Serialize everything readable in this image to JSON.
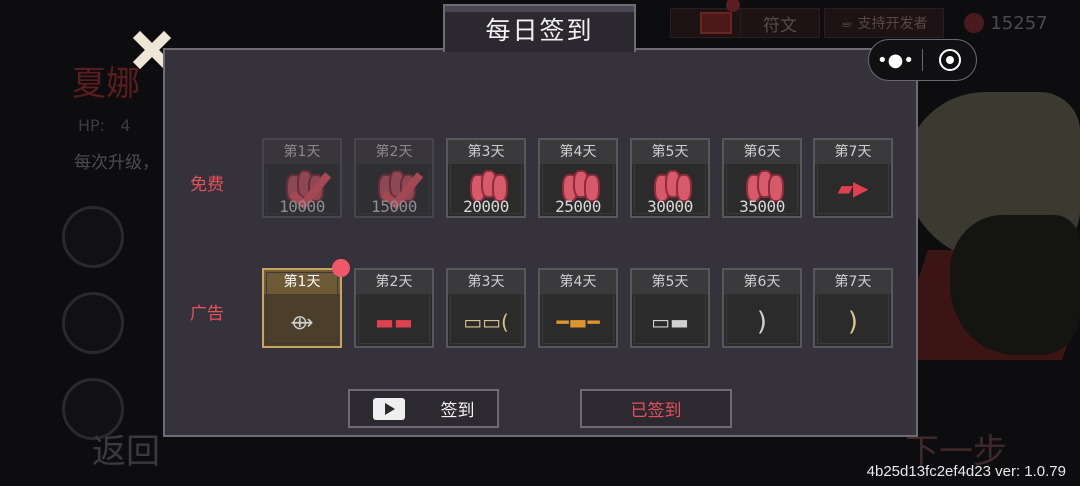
{
  "background": {
    "character_name": "夏娜",
    "hp_label": "HP:",
    "hp_value": "4",
    "upgrade_text": "每次升级，",
    "back_label": "返回",
    "next_label": "下一步",
    "top_bar": {
      "runes_label": "符文",
      "support_label": "支持开发者",
      "coins": "15257"
    }
  },
  "dialog": {
    "title": "每日签到",
    "free_row": {
      "label": "免费",
      "days": [
        {
          "day": "第1天",
          "amount": "10000",
          "claimed": true,
          "icon": "coins-icon"
        },
        {
          "day": "第2天",
          "amount": "15000",
          "claimed": true,
          "icon": "coins-icon"
        },
        {
          "day": "第3天",
          "amount": "20000",
          "claimed": false,
          "icon": "coins-icon"
        },
        {
          "day": "第4天",
          "amount": "25000",
          "claimed": false,
          "icon": "coins-icon"
        },
        {
          "day": "第5天",
          "amount": "30000",
          "claimed": false,
          "icon": "coins-icon"
        },
        {
          "day": "第6天",
          "amount": "35000",
          "claimed": false,
          "icon": "coins-icon"
        },
        {
          "day": "第7天",
          "amount": "",
          "claimed": false,
          "icon": "red-gun-icon"
        }
      ]
    },
    "ad_row": {
      "label": "广告",
      "days": [
        {
          "day": "第1天",
          "active": true,
          "icon": "crossbow-icon"
        },
        {
          "day": "第2天",
          "active": false,
          "icon": "red-blaster-icon"
        },
        {
          "day": "第3天",
          "active": false,
          "icon": "khaki-gun-icon"
        },
        {
          "day": "第4天",
          "active": false,
          "icon": "orange-rifle-icon"
        },
        {
          "day": "第5天",
          "active": false,
          "icon": "silver-pistol-icon"
        },
        {
          "day": "第6天",
          "active": false,
          "icon": "bow-icon"
        },
        {
          "day": "第7天",
          "active": false,
          "icon": "golden-bow-icon"
        }
      ]
    },
    "ad_button_label": "签到",
    "signed_button_label": "已签到"
  },
  "version_text": "4b25d13fc2ef4d23 ver: 1.0.79",
  "colors": {
    "accent_red": "#e7505a",
    "active_gold": "#c9a55e",
    "panel": "#36323b"
  }
}
